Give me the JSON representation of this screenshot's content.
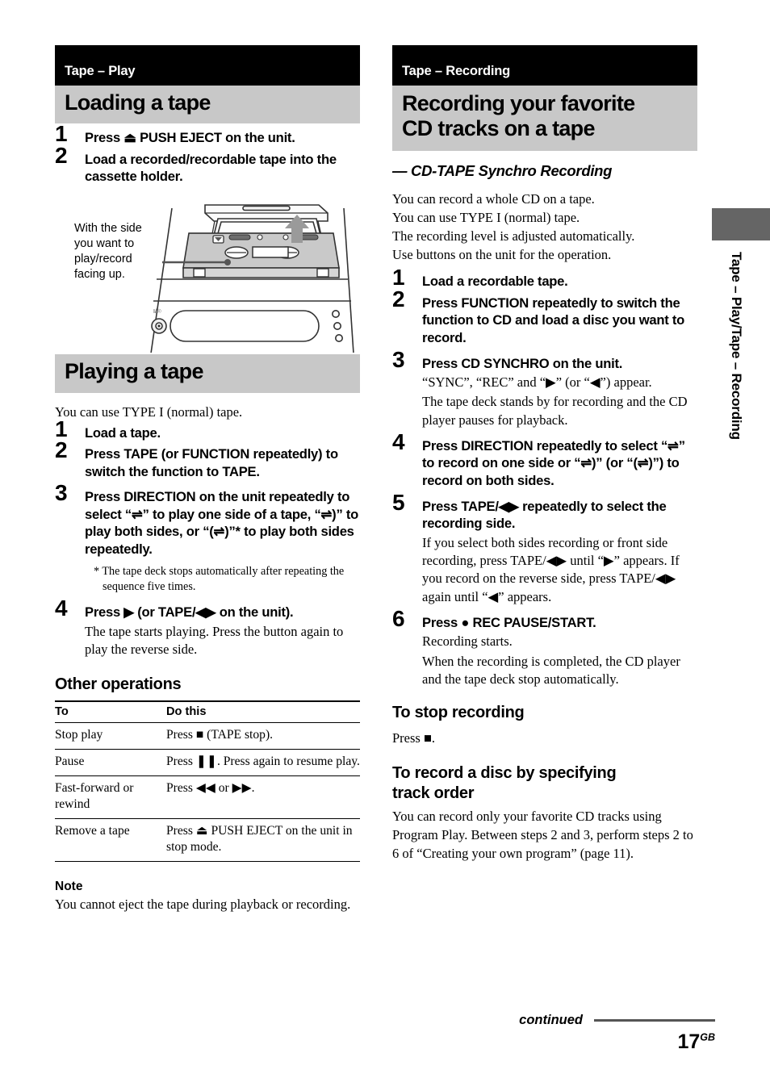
{
  "left": {
    "section_label": "Tape – Play",
    "heading1": "Loading a tape",
    "loading_steps": [
      {
        "num": "1",
        "title": "Press ⏏ PUSH EJECT on the unit."
      },
      {
        "num": "2",
        "title": "Load a recorded/recordable tape into the cassette holder."
      }
    ],
    "illustration_caption": "With the side you want to play/record facing up.",
    "heading2": "Playing a tape",
    "playing_lead": "You can use TYPE I (normal) tape.",
    "playing_steps": [
      {
        "num": "1",
        "title": "Load a tape."
      },
      {
        "num": "2",
        "title": "Press TAPE (or FUNCTION repeatedly) to switch the function to TAPE."
      },
      {
        "num": "3",
        "title": "Press DIRECTION on the unit repeatedly to select “⇌” to play one side of a tape, “⇌)” to play both sides, or “(⇌)”* to play both sides repeatedly.",
        "footnote": "* The tape deck stops automatically after repeating the sequence five times."
      },
      {
        "num": "4",
        "title": "Press ▶ (or TAPE/◀▶ on the unit).",
        "body": "The tape starts playing. Press the button again to play the reverse side."
      }
    ],
    "other_ops_heading": "Other operations",
    "table": {
      "headers": [
        "To",
        "Do this"
      ],
      "rows": [
        [
          "Stop play",
          "Press ■ (TAPE stop)."
        ],
        [
          "Pause",
          "Press ❚❚. Press again to resume play."
        ],
        [
          "Fast-forward or rewind",
          "Press ◀◀ or ▶▶."
        ],
        [
          "Remove a tape",
          "Press ⏏ PUSH EJECT on the unit in stop mode."
        ]
      ]
    },
    "note_heading": "Note",
    "note_body": "You cannot eject the tape during playback or recording."
  },
  "right": {
    "section_label": "Tape – Recording",
    "heading1_line1": "Recording your favorite",
    "heading1_line2": "CD tracks on a tape",
    "subtitle": "— CD-TAPE Synchro Recording",
    "lead_lines": [
      "You can record a whole CD on a tape.",
      "You can use TYPE I (normal) tape.",
      "The recording level is adjusted automatically.",
      "Use buttons on the unit for the operation."
    ],
    "steps": [
      {
        "num": "1",
        "title": "Load a recordable tape."
      },
      {
        "num": "2",
        "title": "Press FUNCTION repeatedly to switch the function to CD and load a disc you want to record."
      },
      {
        "num": "3",
        "title": "Press CD SYNCHRO on the unit.",
        "body1": "“SYNC”, “REC” and “▶” (or “◀”) appear.",
        "body2": "The tape deck stands by for recording and the CD player pauses for playback."
      },
      {
        "num": "4",
        "title": "Press DIRECTION repeatedly to select “⇌” to record on one side or “⇌)” (or “(⇌)”) to record on both sides."
      },
      {
        "num": "5",
        "title": "Press TAPE/◀▶ repeatedly to select the recording side.",
        "body1": "If you select both sides recording or front side recording, press TAPE/◀▶ until “▶” appears. If you record on the reverse side, press TAPE/◀▶ again until “◀” appears."
      },
      {
        "num": "6",
        "title": "Press ● REC PAUSE/START.",
        "body1": "Recording starts.",
        "body2": "When the recording is completed, the CD player and the tape deck stop automatically."
      }
    ],
    "stop_heading": "To stop recording",
    "stop_body": "Press ■.",
    "order_heading_line1": "To record a disc by specifying",
    "order_heading_line2": "track order",
    "order_body": "You can record only your favorite CD tracks using Program Play. Between steps 2 and 3, perform steps 2 to 6 of “Creating your own program” (page 11)."
  },
  "side_tab": {
    "text": "Tape – Play/Tape – Recording"
  },
  "footer": {
    "continued": "continued",
    "page_number": "17",
    "page_suffix": "GB"
  }
}
